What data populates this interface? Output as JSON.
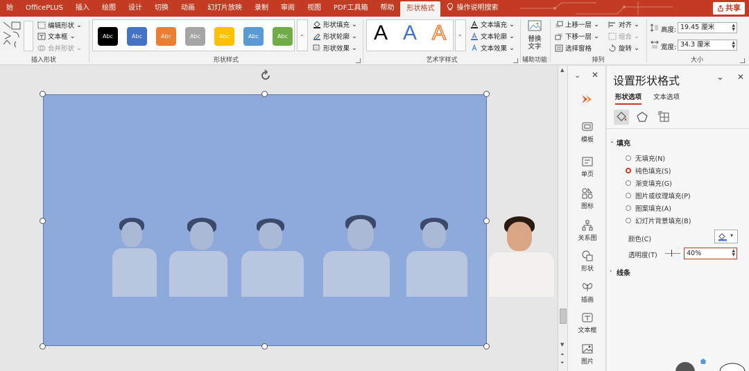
{
  "tabs": {
    "t0": "始",
    "t1": "OfficePLUS",
    "t2": "插入",
    "t3": "绘图",
    "t4": "设计",
    "t5": "切换",
    "t6": "动画",
    "t7": "幻灯片放映",
    "t8": "录制",
    "t9": "审阅",
    "t10": "视图",
    "t11": "PDF工具箱",
    "t12": "帮助",
    "t13": "形状格式",
    "t14": "操作说明搜索"
  },
  "share": "共享",
  "ribbon": {
    "insert_shape": {
      "label": "插入形状",
      "edit_shape": "编辑形状",
      "text_box": "文本框",
      "merge_shapes": "合并形状"
    },
    "shape_styles": {
      "label": "形状样式",
      "swatch_text": "Abc",
      "swatches": [
        "#000000",
        "#4472c4",
        "#ed7d31",
        "#a5a5a5",
        "#ffc000",
        "#5b9bd5",
        "#70ad47"
      ],
      "fill": "形状填充",
      "outline": "形状轮廓",
      "effects": "形状效果"
    },
    "wordart": {
      "label": "艺术字样式",
      "letter": "A",
      "text_fill": "文本填充",
      "text_outline": "文本轮廓",
      "text_effects": "文本效果"
    },
    "accessibility": {
      "label": "辅助功能",
      "alt_text_1": "替换",
      "alt_text_2": "文字"
    },
    "arrange": {
      "label": "排列",
      "bring_forward": "上移一层",
      "send_backward": "下移一层",
      "selection_pane": "选择窗格",
      "align": "对齐",
      "group": "组合",
      "rotate": "旋转"
    },
    "size": {
      "label": "大小",
      "height_label": "高度:",
      "height_value": "19.45 厘米",
      "width_label": "宽度:",
      "width_value": "34.3 厘米"
    }
  },
  "sidebar": {
    "template": "模板",
    "single_page": "单页",
    "icons": "图标",
    "relationship": "关系图",
    "shapes": "形状",
    "illustration": "插画",
    "text_box": "文本框",
    "picture": "图片"
  },
  "pane": {
    "title": "设置形状格式",
    "tab_shape": "形状选项",
    "tab_text": "文本选项",
    "fill_section": "填充",
    "options": [
      "无填充(N)",
      "纯色填充(S)",
      "渐变填充(G)",
      "图片或纹理填充(P)",
      "图案填充(A)",
      "幻灯片背景填充(B)"
    ],
    "selected_option": "纯色填充(S)",
    "color_label": "颜色(C)",
    "transparency_label": "透明度(T)",
    "transparency_value": "40%",
    "line_section": "线条"
  },
  "colors": {
    "accent": "#c23b22",
    "shape_fill": "#8eaadc",
    "shape_border": "#5a78ae"
  }
}
